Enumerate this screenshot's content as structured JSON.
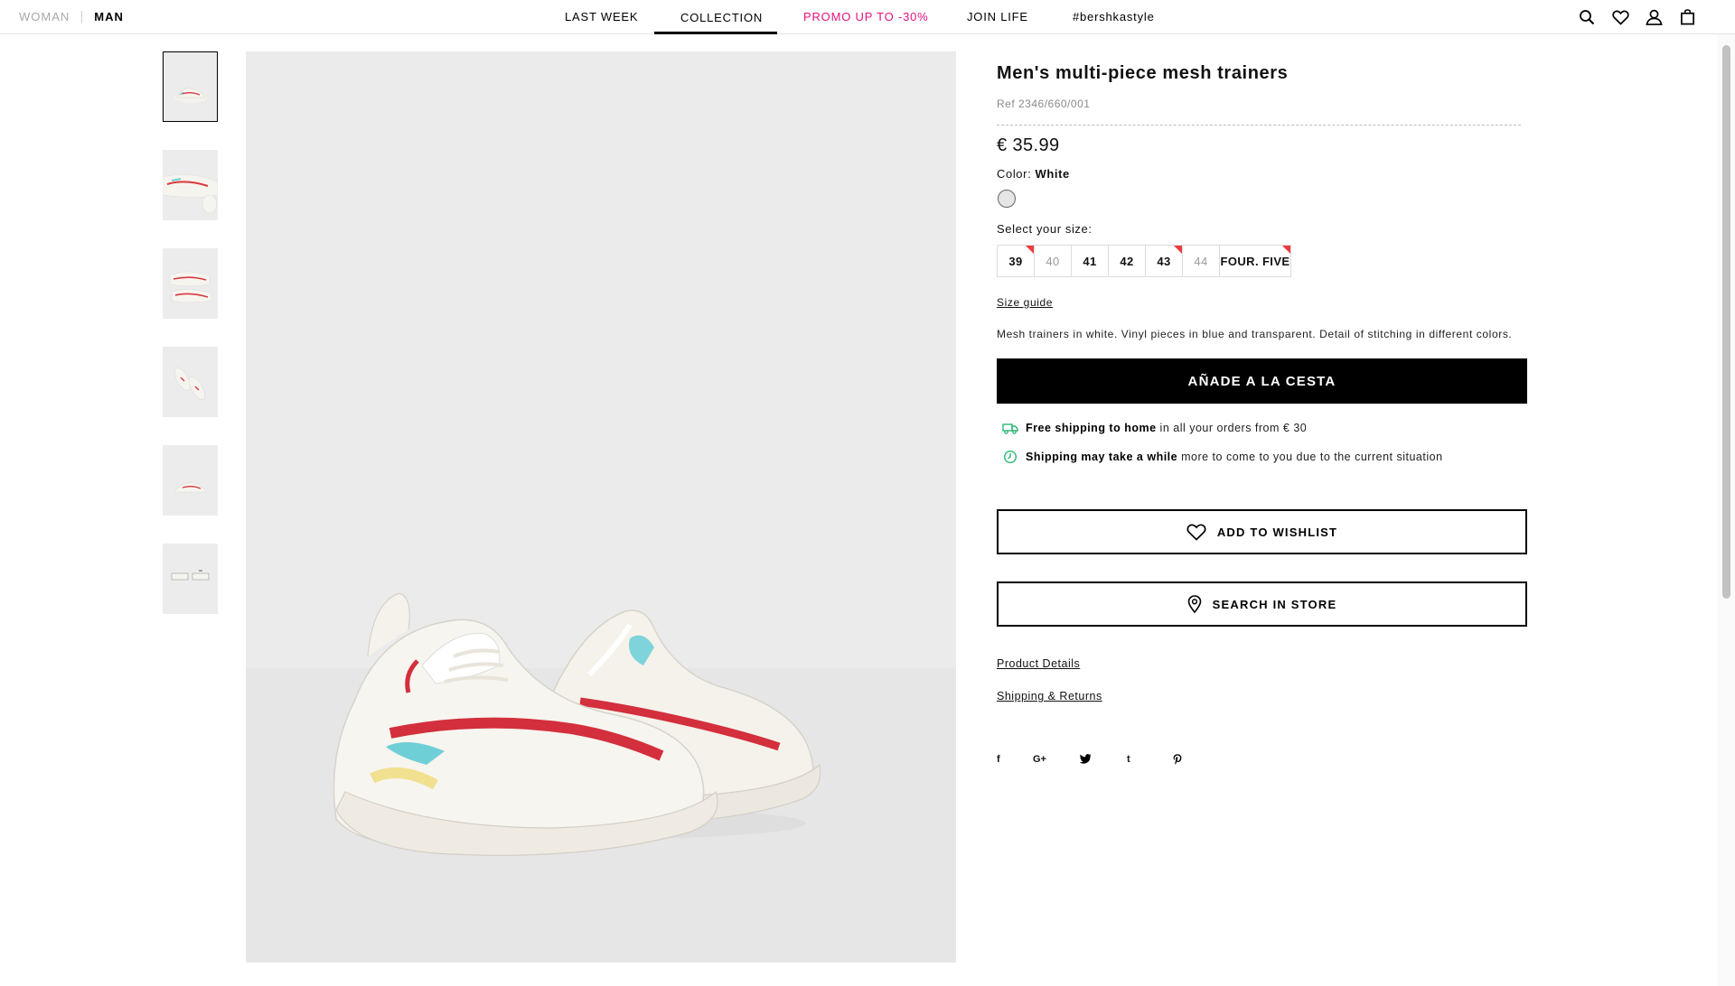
{
  "header": {
    "gender": {
      "woman": "WOMAN",
      "man": "MAN"
    },
    "nav": [
      {
        "label": "LAST WEEK"
      },
      {
        "label": "COLLECTION"
      },
      {
        "label": "PROMO UP TO -30%"
      },
      {
        "label": "JOIN LIFE"
      },
      {
        "label": "#bershkastyle"
      }
    ],
    "active_nav": "COLLECTION",
    "promo_color": "#e6127e",
    "icons": [
      "search-icon",
      "heart-icon",
      "user-icon",
      "bag-icon"
    ]
  },
  "thumbnails": {
    "count": 6,
    "selected_index": 0
  },
  "product": {
    "title": "Men's multi-piece mesh trainers",
    "ref": "Ref 2346/660/001",
    "price": "€ 35.99",
    "color_label": "Color:",
    "color_value": "White",
    "size_label": "Select your size:",
    "sizes": [
      {
        "label": "39",
        "available": true,
        "low_stock": true
      },
      {
        "label": "40",
        "available": false,
        "low_stock": false
      },
      {
        "label": "41",
        "available": true,
        "low_stock": false
      },
      {
        "label": "42",
        "available": true,
        "low_stock": false
      },
      {
        "label": "43",
        "available": true,
        "low_stock": true
      },
      {
        "label": "44",
        "available": false,
        "low_stock": false
      },
      {
        "label": "FOUR. FIVE",
        "available": true,
        "low_stock": true
      }
    ],
    "size_guide": "Size guide",
    "description": "Mesh trainers in white. Vinyl pieces in blue and transparent. Detail of stitching in different colors.",
    "add_to_cart": "AÑADE A LA CESTA",
    "shipping": [
      {
        "bold": "Free shipping to home",
        "text": "in all your orders from € 30",
        "icon": "truck-icon"
      },
      {
        "bold": "Shipping may take a while",
        "text": "more to come to you due to the current situation",
        "icon": "clock-icon"
      }
    ],
    "accent_color": "#2bb673",
    "wishlist": "ADD TO WISHLIST",
    "search_store": "SEARCH IN STORE",
    "links": [
      "Product Details",
      "Shipping & Returns"
    ],
    "social": [
      "f",
      "G+",
      "twitter-icon",
      "t",
      "pinterest-icon"
    ]
  }
}
